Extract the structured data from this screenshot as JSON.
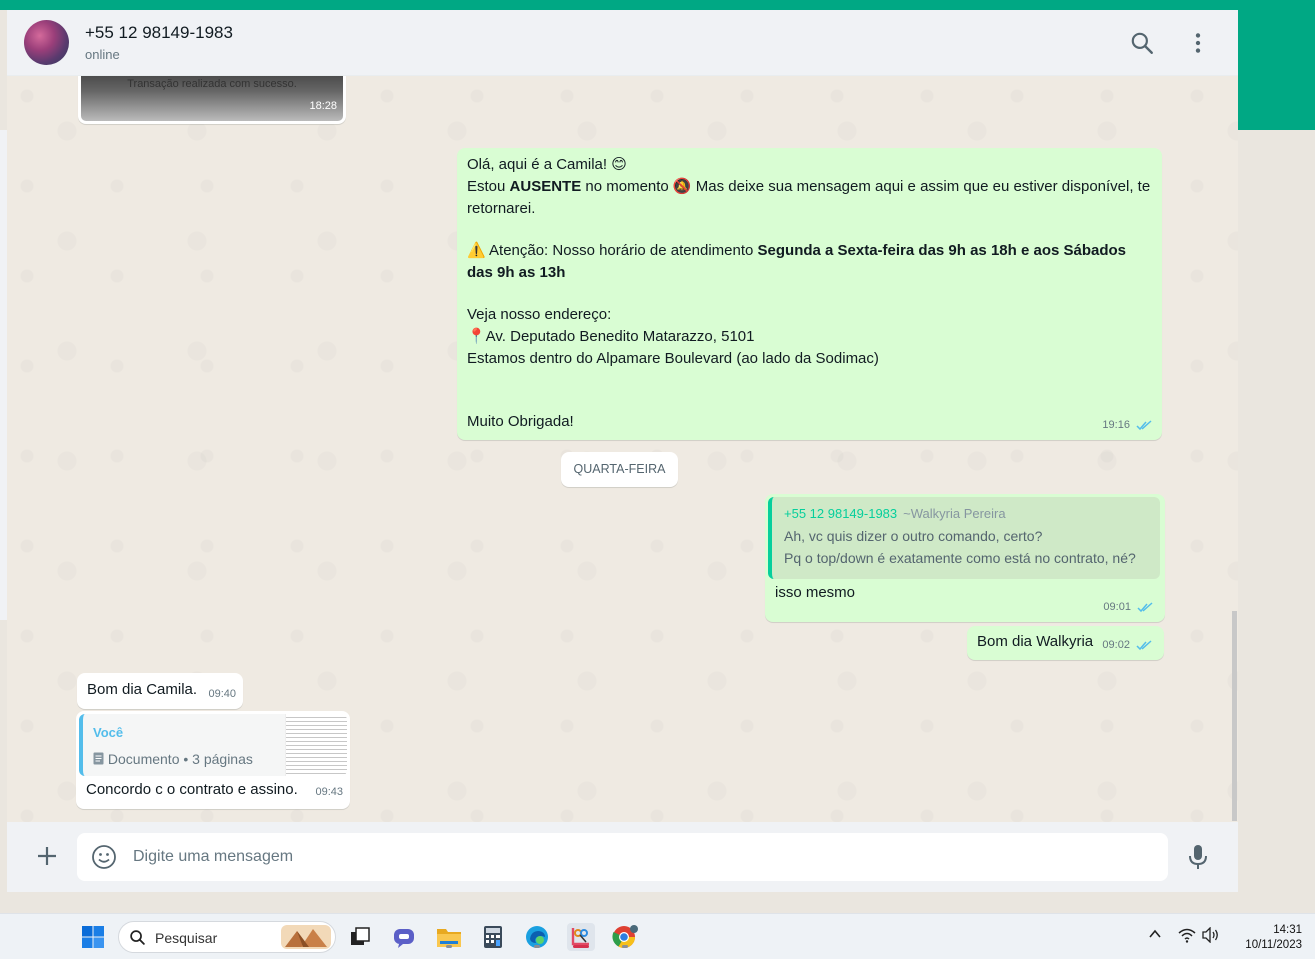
{
  "header": {
    "contact_name": "+55 12 98149-1983",
    "status": "online"
  },
  "messages": {
    "image_msg": {
      "caption": "Transação realizada com sucesso.",
      "time": "18:28"
    },
    "auto_reply": {
      "line1": "Olá, aqui é a Camila! 😊",
      "line2_a": "Estou ",
      "line2_bold": "AUSENTE",
      "line2_b": " no momento 🔕 Mas deixe sua mensagem aqui e assim que eu estiver disponível, te retornarei.",
      "attention_a": "⚠️ Atenção: Nosso horário de atendimento ",
      "attention_bold": "Segunda a Sexta-feira das 9h as 18h e aos Sábados das 9h as 13h",
      "address_title": "Veja nosso endereço:",
      "address_line": "📍Av. Deputado Benedito Matarazzo, 5101",
      "address_note": "Estamos dentro do Alpamare Boulevard (ao lado da Sodimac)",
      "thanks": "Muito Obrigada!",
      "time": "19:16"
    },
    "day_divider": "QUARTA-FEIRA",
    "reply_msg": {
      "quote_author": "+55 12 98149-1983",
      "quote_pushname": "~Walkyria Pereira",
      "quote_line1": "Ah, vc quis dizer o outro comando, certo?",
      "quote_line2": "Pq o top/down é exatamente como está no contrato, né?",
      "text": "isso mesmo",
      "time": "09:01"
    },
    "out_greeting": {
      "text": "Bom dia Walkyria",
      "time": "09:02"
    },
    "in_greeting": {
      "text": "Bom dia Camila.",
      "time": "09:40"
    },
    "doc_reply": {
      "quote_author": "Você",
      "doc_label": "Documento • 3 páginas",
      "text": "Concordo c o contrato e assino.",
      "time": "09:43"
    }
  },
  "composer": {
    "placeholder": "Digite uma mensagem"
  },
  "taskbar": {
    "search_label": "Pesquisar",
    "clock_time": "14:31",
    "clock_date": "10/11/2023"
  },
  "colors": {
    "accent": "#00a884",
    "outgoing_bubble": "#d9fdd3",
    "incoming_bubble": "#ffffff",
    "read_ticks": "#53bdeb"
  }
}
